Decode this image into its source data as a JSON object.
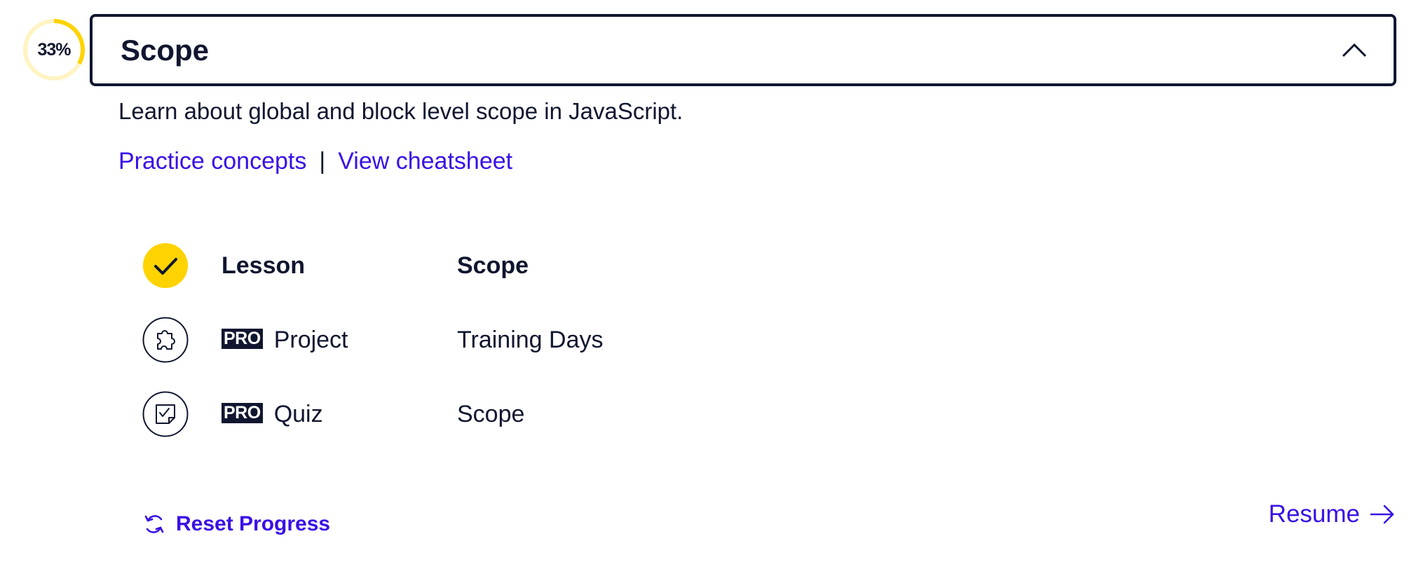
{
  "progress": {
    "label": "33%",
    "fraction": 0.33,
    "ring_color": "#ffd300",
    "track_color": "#fff4c2"
  },
  "module": {
    "title": "Scope",
    "expanded": true,
    "collapse_icon": "chevron-up-icon",
    "description": "Learn about global and block level scope in JavaScript.",
    "links": {
      "practice": "Practice concepts",
      "separator": "|",
      "cheatsheet": "View cheatsheet"
    }
  },
  "items": [
    {
      "type": "Lesson",
      "title": "Scope",
      "pro": false,
      "completed": true,
      "icon": "checkmark-icon"
    },
    {
      "type": "Project",
      "title": "Training Days",
      "pro": true,
      "pro_label": "PRO",
      "completed": false,
      "icon": "puzzle-icon"
    },
    {
      "type": "Quiz",
      "title": "Scope",
      "pro": true,
      "pro_label": "PRO",
      "completed": false,
      "icon": "quiz-icon"
    }
  ],
  "footer": {
    "reset_label": "Reset Progress",
    "reset_icon": "refresh-icon",
    "resume_label": "Resume",
    "resume_icon": "arrow-right-icon"
  },
  "colors": {
    "ink": "#10162f",
    "link": "#3a10e5",
    "accent": "#ffd300"
  }
}
